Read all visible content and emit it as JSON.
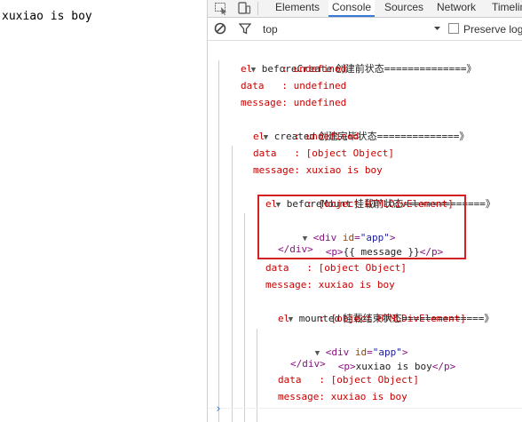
{
  "page": {
    "body_text": "xuxiao is boy"
  },
  "devtools": {
    "tabs": [
      "Elements",
      "Console",
      "Sources",
      "Network",
      "Timeline"
    ],
    "active_tab": "Console",
    "filter_context": "top",
    "preserve_log_label": "Preserve log",
    "accent_color": "#3879d9",
    "highlight_color": "#d32020"
  },
  "console": {
    "before_create": {
      "header_code": "beforeCreate",
      "header_cn": " 创建前状态",
      "header_eq": "==============》",
      "el": "el     : undefined",
      "data": "data   : undefined",
      "message": "message: undefined"
    },
    "created": {
      "header_code": "created",
      "header_cn": " 创建完毕状态",
      "header_eq": "==============》",
      "el": "el     : undefined",
      "data": "data   : [object Object]",
      "message": "message: xuxiao is boy"
    },
    "before_mount": {
      "header_code": "beforeMount",
      "header_cn": " 挂载前状态",
      "header_eq": "==============》",
      "el": "el     : [object HTMLDivElement]",
      "dom_open_tag": "div",
      "dom_attr_name": "id",
      "dom_attr_value": "\"app\"",
      "dom_child_tag": "p",
      "dom_child_text": "{{ message }}",
      "dom_close": "</div>",
      "data": "data   : [object Object]",
      "message": "message: xuxiao is boy"
    },
    "mounted": {
      "header_code": "mounted",
      "header_cn": " 挂载结束状态",
      "header_eq": "==============》",
      "el": "el     : [object HTMLDivElement]",
      "dom_open_tag": "div",
      "dom_attr_name": "id",
      "dom_attr_value": "\"app\"",
      "dom_child_tag": "p",
      "dom_child_text": "xuxiao is boy",
      "dom_close": "</div>",
      "data": "data   : [object Object]",
      "message": "message: xuxiao is boy"
    }
  },
  "icons": {
    "inspect": "inspect-element-icon",
    "device": "device-mode-icon",
    "clear": "clear-console-icon",
    "filter": "filter-icon",
    "dropdown": "dropdown-arrow-icon",
    "prompt": "console-prompt-icon",
    "expand": "expanded-triangle-icon"
  }
}
